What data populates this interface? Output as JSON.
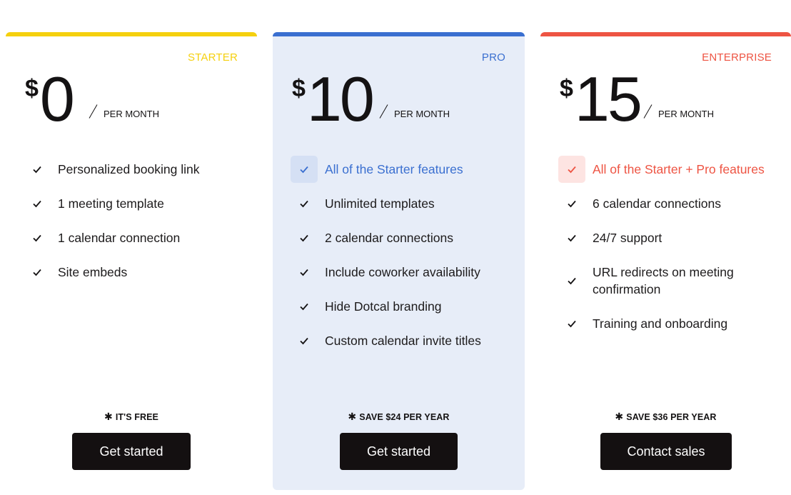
{
  "colors": {
    "starter_accent": "#f5d00e",
    "pro_accent": "#3a6fd0",
    "pro_background": "#e7edf8",
    "pro_check_bg": "#d5e0f4",
    "enterprise_accent": "#ee5443",
    "enterprise_check_bg": "#fde4e2",
    "button_bg": "#141011"
  },
  "plans": [
    {
      "tier": "STARTER",
      "currency": "$",
      "amount": "0",
      "period": "PER MONTH",
      "features": [
        {
          "text": "Personalized booking link",
          "icon": "check-icon",
          "highlight": false
        },
        {
          "text": "1 meeting template",
          "icon": "check-icon",
          "highlight": false
        },
        {
          "text": "1 calendar connection",
          "icon": "check-icon",
          "highlight": false
        },
        {
          "text": "Site embeds",
          "icon": "check-icon",
          "highlight": false
        }
      ],
      "note_icon": "asterisk-icon",
      "note": "IT'S FREE",
      "button": "Get started"
    },
    {
      "tier": "PRO",
      "currency": "$",
      "amount": "10",
      "period": "PER MONTH",
      "features": [
        {
          "text": "All of the Starter features",
          "icon": "check-icon",
          "highlight": true
        },
        {
          "text": "Unlimited templates",
          "icon": "check-icon",
          "highlight": false
        },
        {
          "text": "2 calendar connections",
          "icon": "check-icon",
          "highlight": false
        },
        {
          "text": "Include coworker availability",
          "icon": "check-icon",
          "highlight": false
        },
        {
          "text": "Hide Dotcal branding",
          "icon": "check-icon",
          "highlight": false
        },
        {
          "text": "Custom calendar invite titles",
          "icon": "check-icon",
          "highlight": false
        }
      ],
      "note_icon": "asterisk-icon",
      "note": "SAVE $24 PER YEAR",
      "button": "Get started"
    },
    {
      "tier": "ENTERPRISE",
      "currency": "$",
      "amount": "15",
      "period": "PER MONTH",
      "features": [
        {
          "text": "All of the Starter + Pro features",
          "icon": "check-icon",
          "highlight": true
        },
        {
          "text": "6 calendar connections",
          "icon": "check-icon",
          "highlight": false
        },
        {
          "text": "24/7 support",
          "icon": "check-icon",
          "highlight": false
        },
        {
          "text": "URL redirects on meeting confirmation",
          "icon": "check-icon",
          "highlight": false
        },
        {
          "text": "Training and onboarding",
          "icon": "check-icon",
          "highlight": false
        }
      ],
      "note_icon": "asterisk-icon",
      "note": "SAVE $36 PER YEAR",
      "button": "Contact sales"
    }
  ]
}
